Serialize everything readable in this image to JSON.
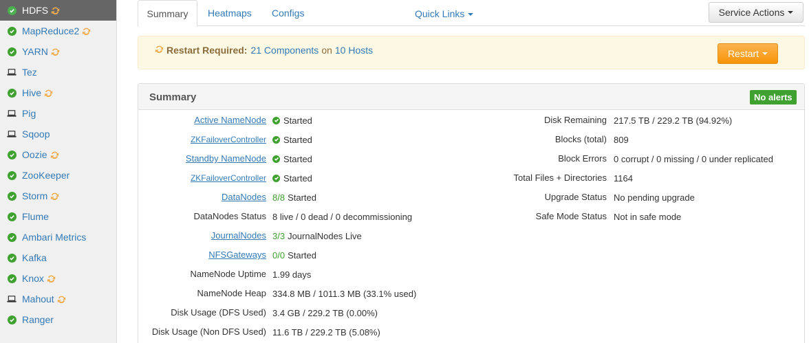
{
  "sidebar": {
    "items": [
      {
        "label": "HDFS",
        "status": "started",
        "restart": true,
        "active": true
      },
      {
        "label": "MapReduce2",
        "status": "started",
        "restart": true
      },
      {
        "label": "YARN",
        "status": "started",
        "restart": true
      },
      {
        "label": "Tez",
        "status": "client",
        "restart": false
      },
      {
        "label": "Hive",
        "status": "started",
        "restart": true
      },
      {
        "label": "Pig",
        "status": "client",
        "restart": false
      },
      {
        "label": "Sqoop",
        "status": "client",
        "restart": false
      },
      {
        "label": "Oozie",
        "status": "started",
        "restart": true
      },
      {
        "label": "ZooKeeper",
        "status": "started",
        "restart": false
      },
      {
        "label": "Storm",
        "status": "started",
        "restart": true
      },
      {
        "label": "Flume",
        "status": "started",
        "restart": false
      },
      {
        "label": "Ambari Metrics",
        "status": "started",
        "restart": false
      },
      {
        "label": "Kafka",
        "status": "started",
        "restart": false
      },
      {
        "label": "Knox",
        "status": "started",
        "restart": true
      },
      {
        "label": "Mahout",
        "status": "client",
        "restart": true
      },
      {
        "label": "Ranger",
        "status": "started",
        "restart": false
      }
    ]
  },
  "tabs": {
    "summary": "Summary",
    "heatmaps": "Heatmaps",
    "configs": "Configs",
    "quick_links": "Quick Links",
    "service_actions": "Service Actions"
  },
  "restart_banner": {
    "title": "Restart Required:",
    "components": "21 Components",
    "on": "on",
    "hosts": "10 Hosts",
    "button": "Restart"
  },
  "summary": {
    "title": "Summary",
    "alerts_badge": "No alerts",
    "left": [
      {
        "label": "Active NameNode",
        "link": true,
        "small": false,
        "icon": true,
        "value": "Started"
      },
      {
        "label": "ZKFailoverController",
        "link": true,
        "small": true,
        "icon": true,
        "value": "Started"
      },
      {
        "label": "Standby NameNode",
        "link": true,
        "small": false,
        "icon": true,
        "value": "Started"
      },
      {
        "label": "ZKFailoverController",
        "link": true,
        "small": true,
        "icon": true,
        "value": "Started"
      },
      {
        "label": "DataNodes",
        "link": true,
        "small": false,
        "icon": false,
        "green": "8/8",
        "value": "Started"
      },
      {
        "label": "DataNodes Status",
        "link": false,
        "small": false,
        "icon": false,
        "value": "8 live / 0 dead / 0 decommissioning"
      },
      {
        "label": "JournalNodes",
        "link": true,
        "small": false,
        "icon": false,
        "green": "3/3",
        "value": "JournalNodes Live"
      },
      {
        "label": "NFSGateways",
        "link": true,
        "small": false,
        "icon": false,
        "green": "0/0",
        "value": "Started"
      },
      {
        "label": "NameNode Uptime",
        "link": false,
        "small": false,
        "icon": false,
        "value": "1.99 days"
      },
      {
        "label": "NameNode Heap",
        "link": false,
        "small": false,
        "icon": false,
        "value": "334.8 MB / 1011.3 MB (33.1% used)"
      },
      {
        "label": "Disk Usage (DFS Used)",
        "link": false,
        "small": false,
        "icon": false,
        "value": "3.4 GB / 229.2 TB (0.00%)"
      },
      {
        "label": "Disk Usage (Non DFS Used)",
        "link": false,
        "small": false,
        "icon": false,
        "value": "11.6 TB / 229.2 TB (5.08%)"
      }
    ],
    "right": [
      {
        "label": "Disk Remaining",
        "value": "217.5 TB / 229.2 TB (94.92%)"
      },
      {
        "label": "Blocks (total)",
        "value": "809"
      },
      {
        "label": "Block Errors",
        "value": "0 corrupt / 0 missing / 0 under replicated"
      },
      {
        "label": "Total Files + Directories",
        "value": "1164"
      },
      {
        "label": "Upgrade Status",
        "value": "No pending upgrade"
      },
      {
        "label": "Safe Mode Status",
        "value": "Not in safe mode"
      }
    ]
  },
  "colors": {
    "ok_green": "#3fa12f",
    "link_blue": "#337ab7",
    "restart_orange": "#f89406"
  }
}
